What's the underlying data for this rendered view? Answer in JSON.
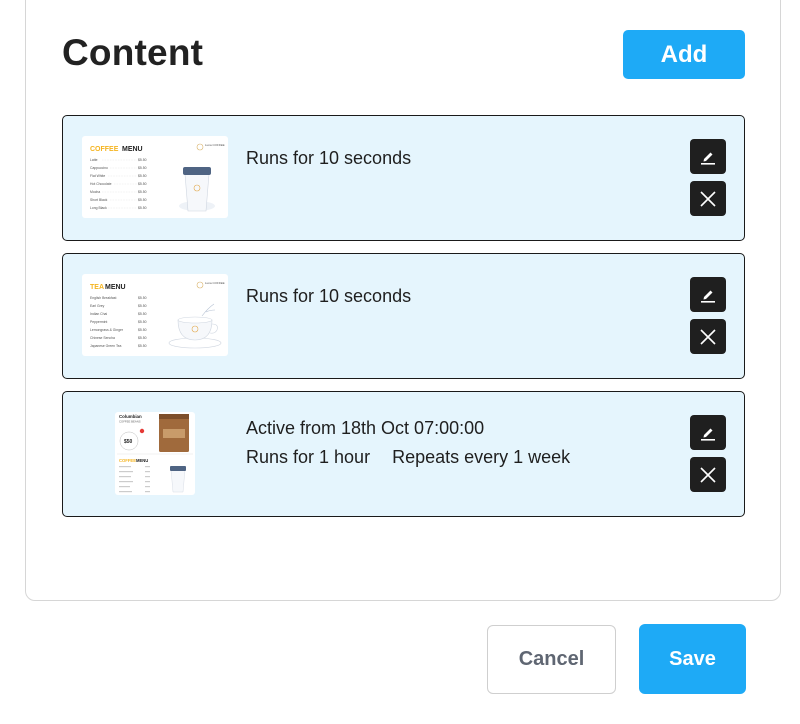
{
  "header": {
    "title": "Content",
    "add_label": "Add"
  },
  "items": [
    {
      "thumbnail": {
        "heading_accent": "COFFEE",
        "heading_rest": " MENU",
        "logo_text": "Luna COFFEE",
        "rows": [
          {
            "name": "Latte",
            "price": "$5.50"
          },
          {
            "name": "Cappuccino",
            "price": "$5.50"
          },
          {
            "name": "Flat White",
            "price": "$5.50"
          },
          {
            "name": "Hot Chocolate",
            "price": "$5.50"
          },
          {
            "name": "Mocha",
            "price": "$5.50"
          },
          {
            "name": "Short Black",
            "price": "$5.50"
          },
          {
            "name": "Long Black",
            "price": "$5.50"
          }
        ]
      },
      "line1": "Runs for 10 seconds",
      "line2": "",
      "line2b": ""
    },
    {
      "thumbnail": {
        "heading_accent": "TEA",
        "heading_rest": " MENU",
        "logo_text": "Luna COFFEE",
        "rows": [
          {
            "name": "English Breakfast",
            "price": "$5.50"
          },
          {
            "name": "Earl Grey",
            "price": "$5.50"
          },
          {
            "name": "Indian Chai",
            "price": "$5.50"
          },
          {
            "name": "Peppermint",
            "price": "$5.50"
          },
          {
            "name": "Lemongrass & Ginger",
            "price": "$5.50"
          },
          {
            "name": "Chinese Sencha",
            "price": "$5.50"
          },
          {
            "name": "Japanese Green Tea",
            "price": "$5.50"
          }
        ]
      },
      "line1": "Runs for 10 seconds",
      "line2": "",
      "line2b": ""
    },
    {
      "thumbnail": {
        "title_top": "Columbian",
        "subtitle_top": "COFFEE BEANS",
        "price_badge": "$50",
        "heading_accent": "COFFEE",
        "heading_rest": " MENU"
      },
      "line1": "Active from 18th Oct 07:00:00",
      "line2": "Runs for 1 hour",
      "line2b": "Repeats every 1 week"
    }
  ],
  "footer": {
    "cancel_label": "Cancel",
    "save_label": "Save"
  },
  "colors": {
    "accent": "#1eaaf6",
    "card_bg": "#e5f5fd",
    "menu_accent": "#f5b41f"
  },
  "icons": {
    "edit": "pencil-icon",
    "delete": "close-icon"
  }
}
